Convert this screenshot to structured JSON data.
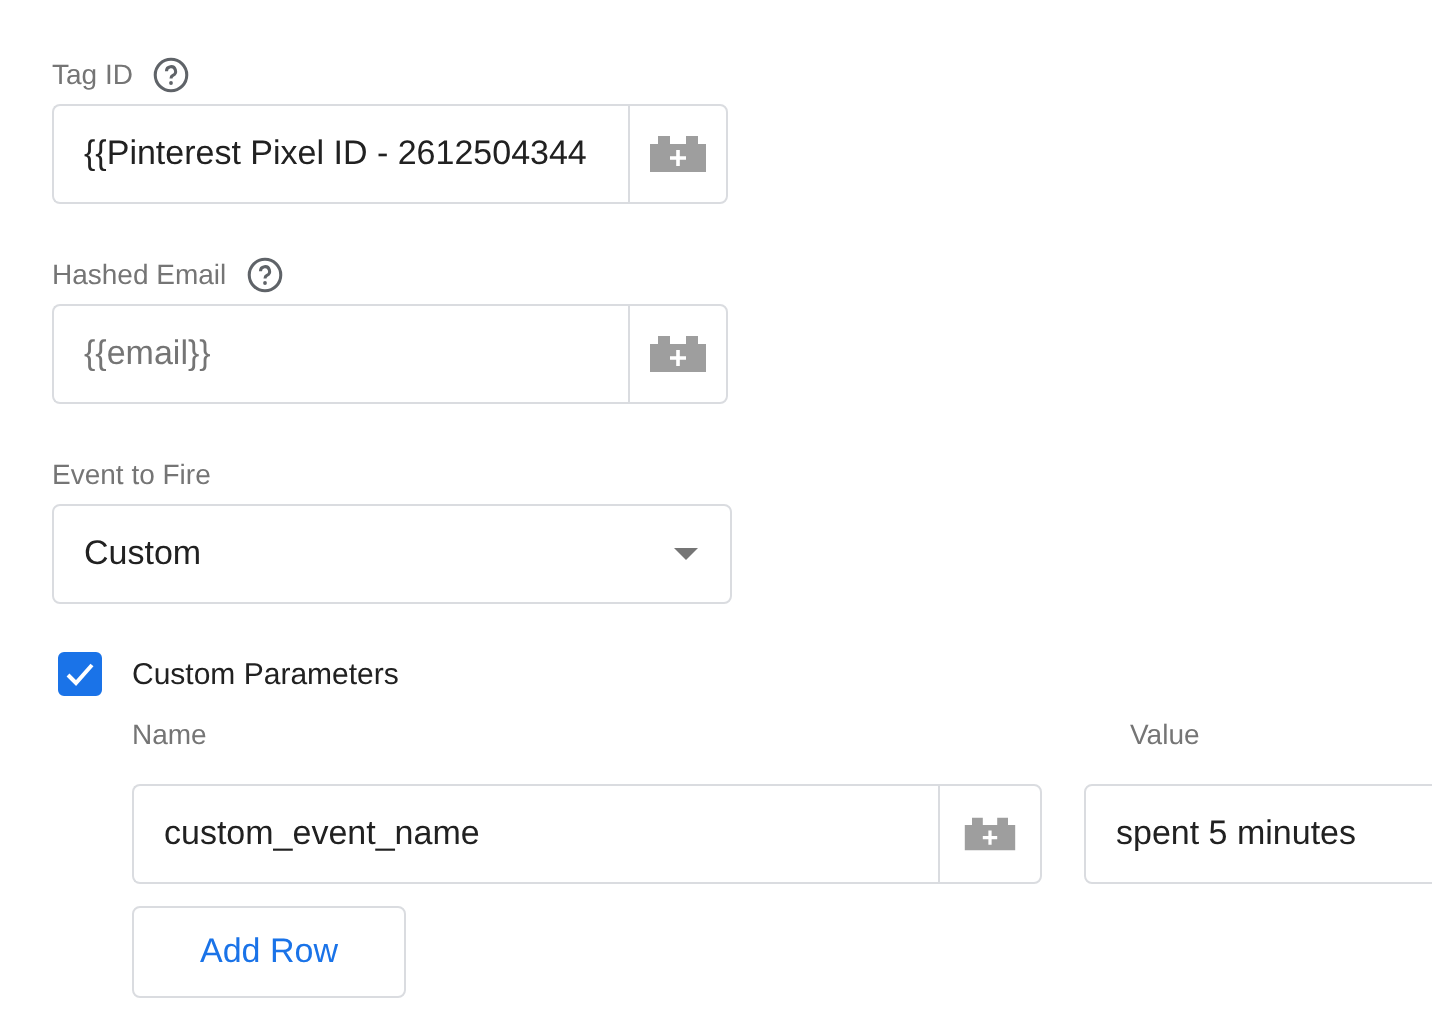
{
  "tag_id": {
    "label": "Tag ID",
    "help": true,
    "value": "{{Pinterest Pixel ID - 2612504344"
  },
  "hashed_email": {
    "label": "Hashed Email",
    "help": true,
    "placeholder": "{{email}}"
  },
  "event_to_fire": {
    "label": "Event to Fire",
    "value": "Custom"
  },
  "custom_parameters": {
    "label": "Custom Parameters",
    "checked": true,
    "columns": [
      "Name",
      "Value"
    ],
    "rows": [
      {
        "name": "custom_event_name",
        "value": "spent 5 minutes"
      }
    ],
    "add_button": "Add Row"
  }
}
